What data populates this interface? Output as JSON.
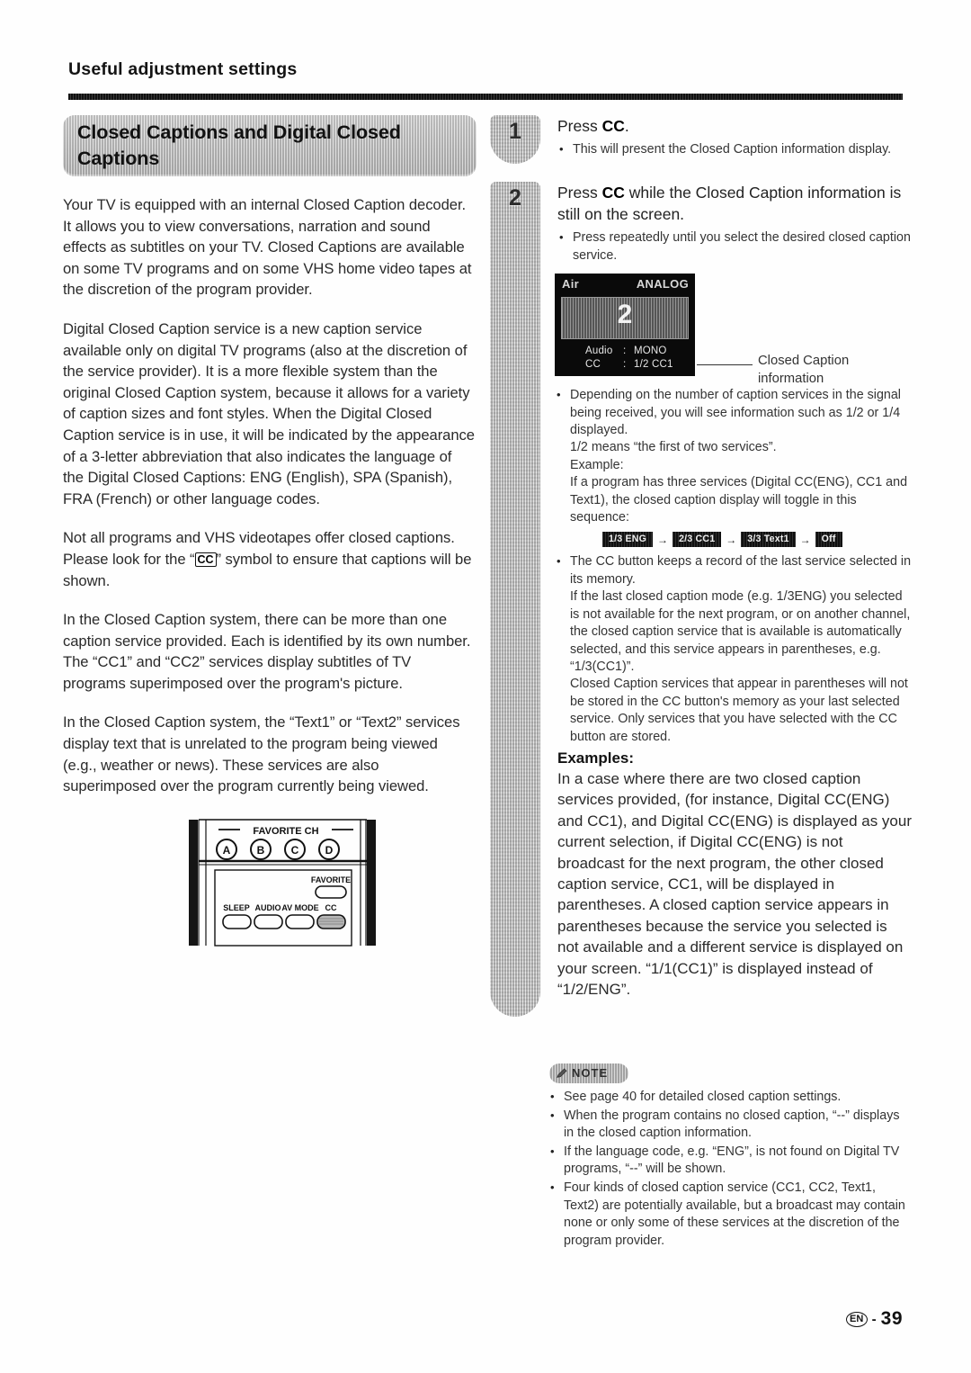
{
  "header": {
    "title": "Useful adjustment settings"
  },
  "section": {
    "banner_title": "Closed Captions and Digital Closed Captions"
  },
  "left_column": {
    "paragraphs": [
      "Your TV is equipped with an internal Closed Caption decoder. It allows you to view conversations, narration and sound effects as subtitles on your TV. Closed Captions are available on some TV programs and on some VHS home video tapes at the discretion of the program provider.",
      "Digital Closed Caption service is a new caption service available only on digital TV programs (also at the discretion of the service provider). It is a more flexible system than the original Closed Caption system, because it allows for a variety of caption sizes and font styles. When the Digital Closed Caption service is in use, it will be indicated by the appearance of a 3-letter abbreviation that also indicates the language of the Digital Closed Captions: ENG (English), SPA (Spanish), FRA (French) or other language codes.",
      "In the Closed Caption system, there can be more than one caption service provided.  Each is identified by its own number. The “CC1” and “CC2” services display subtitles of TV programs superimposed over the program's picture.",
      "In the Closed Caption system, the “Text1” or “Text2” services display text that is unrelated to the program being viewed (e.g., weather or news). These services are also superimposed over the program currently being viewed."
    ],
    "cc_paragraph": {
      "before": "Not all programs and VHS videotapes offer closed captions. Please look for the “",
      "symbol": "CC",
      "after": "” symbol to ensure that captions will be shown."
    }
  },
  "remote": {
    "favorite_ch_label": "FAVORITE CH",
    "round_buttons": [
      "A",
      "B",
      "C",
      "D"
    ],
    "favorite_label": "FAVORITE",
    "bottom_labels": [
      "SLEEP",
      "AUDIO",
      "AV MODE",
      "CC"
    ]
  },
  "steps": [
    {
      "number": "1",
      "title_prefix": "Press ",
      "title_bold": "CC",
      "title_suffix": ".",
      "bullets": [
        "This will present the Closed Caption information display."
      ]
    },
    {
      "number": "2",
      "title_prefix": "Press ",
      "title_bold": "CC",
      "title_suffix": " while the Closed Caption information is still on the screen.",
      "bullets": [
        "Press repeatedly until you select the desired closed caption service."
      ]
    }
  ],
  "tv_display": {
    "source": "Air",
    "mode": "ANALOG",
    "channel": "2",
    "rows": [
      {
        "label": "Audio",
        "sep": ":",
        "value": "MONO"
      },
      {
        "label": "CC",
        "sep": ":",
        "value": "1/2 CC1"
      }
    ],
    "caption": "Closed Caption information"
  },
  "detail_bullet": {
    "lines": [
      "Depending on the number of caption services in the signal being received, you will see information such as 1/2 or 1/4 displayed.",
      "1/2 means “the first of two services”.",
      "Example:",
      "If a program has three services (Digital CC(ENG), CC1 and Text1), the closed caption display will toggle in this sequence:"
    ]
  },
  "toggle_sequence": {
    "chips": [
      "1/3 ENG",
      "2/3 CC1",
      "3/3 Text1",
      "Off"
    ],
    "arrow": "→"
  },
  "memory_bullet": {
    "lines": [
      "The CC button keeps a record of the last service selected in its memory.",
      "If the last closed caption mode (e.g. 1/3ENG) you selected is not available for the next program, or on another channel, the closed caption service that is available is automatically selected, and this service appears in parentheses, e.g. “1/3(CC1)”.",
      "Closed Caption services that appear in parentheses will not be stored in the CC button's memory as your last selected service.  Only services that you have selected with the CC button are stored."
    ]
  },
  "examples": {
    "heading": "Examples:",
    "body": "In a case where there are two closed caption services provided, (for instance, Digital CC(ENG) and CC1), and Digital CC(ENG) is displayed as your current selection, if Digital CC(ENG) is not broadcast for the next program, the other closed caption service, CC1, will be displayed in parentheses. A closed caption service appears in parentheses because the service you selected is not available and a different service is displayed on your screen.  “1/1(CC1)” is displayed instead of “1/2/ENG”."
  },
  "note": {
    "badge_label": "NOTE",
    "items": [
      "See page 40 for detailed closed caption settings.",
      "When the program contains no closed caption, “--” displays in the closed caption information.",
      "If the language code, e.g. “ENG”, is not found on Digital TV programs, “--” will be shown.",
      "Four kinds of closed caption service (CC1, CC2, Text1, Text2) are potentially available, but a broadcast may contain none or only some of these services at the discretion of the program provider."
    ]
  },
  "footer": {
    "language_code": "EN",
    "dash": "-",
    "page_number": "39"
  }
}
